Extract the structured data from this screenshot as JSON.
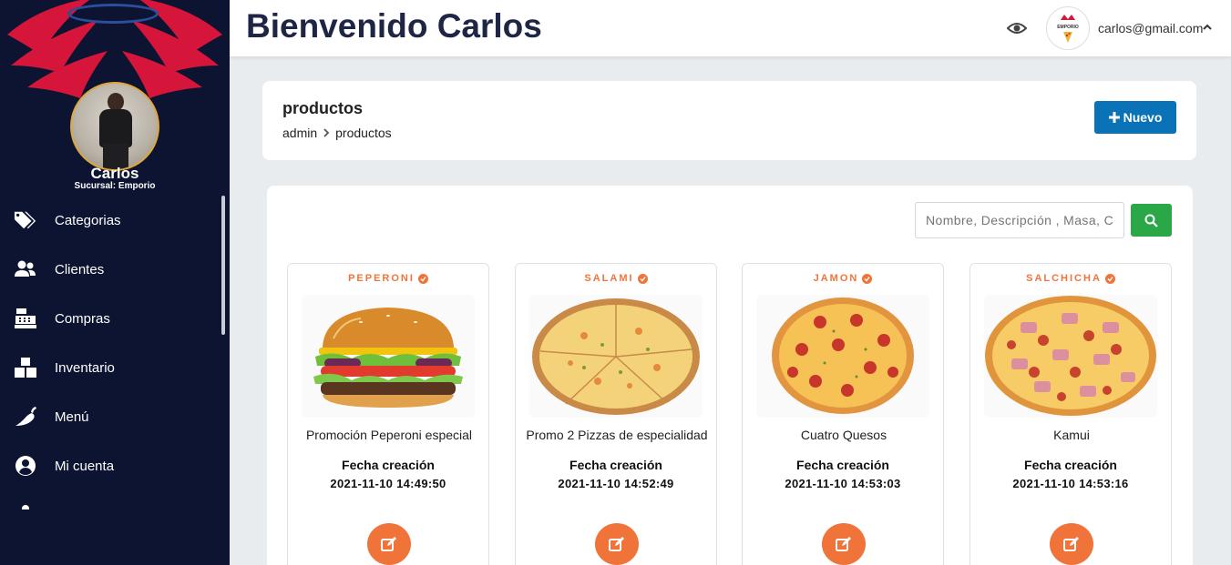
{
  "header": {
    "title": "Bienvenido Carlos",
    "email": "carlos@gmail.com",
    "logo_text": "EMPORIO"
  },
  "sidebar": {
    "user_name": "Carlos",
    "branch": "Sucursal: Emporio",
    "items": [
      {
        "label": "Categorias",
        "icon": "tags-icon"
      },
      {
        "label": "Clientes",
        "icon": "users-icon"
      },
      {
        "label": "Compras",
        "icon": "cash-register-icon"
      },
      {
        "label": "Inventario",
        "icon": "boxes-icon"
      },
      {
        "label": "Menú",
        "icon": "pepper-icon"
      },
      {
        "label": "Mi cuenta",
        "icon": "user-circle-icon"
      }
    ]
  },
  "breadcrumb": {
    "title": "productos",
    "items": [
      "admin",
      "productos"
    ],
    "new_button": "Nuevo"
  },
  "search": {
    "placeholder": "Nombre, Descripción , Masa, Categoría"
  },
  "products": [
    {
      "tag": "PEPERONI",
      "name": "Promoción Peperoni especial",
      "date_label": "Fecha creación",
      "date": "2021-11-10 14:49:50",
      "image": "burger"
    },
    {
      "tag": "SALAMI",
      "name": "Promo 2 Pizzas de especialidad",
      "date_label": "Fecha creación",
      "date": "2021-11-10 14:52:49",
      "image": "pizza-cheese"
    },
    {
      "tag": "JAMON",
      "name": "Cuatro Quesos",
      "date_label": "Fecha creación",
      "date": "2021-11-10 14:53:03",
      "image": "pizza-pepperoni"
    },
    {
      "tag": "SALCHICHA",
      "name": "Kamui",
      "date_label": "Fecha creación",
      "date": "2021-11-10 14:53:16",
      "image": "pizza-ham"
    }
  ],
  "colors": {
    "sidebar_bg": "#0c1431",
    "wings": "#d6153a",
    "accent_orange": "#f0743a",
    "primary_blue": "#0a73b7",
    "search_green": "#2aa847"
  }
}
